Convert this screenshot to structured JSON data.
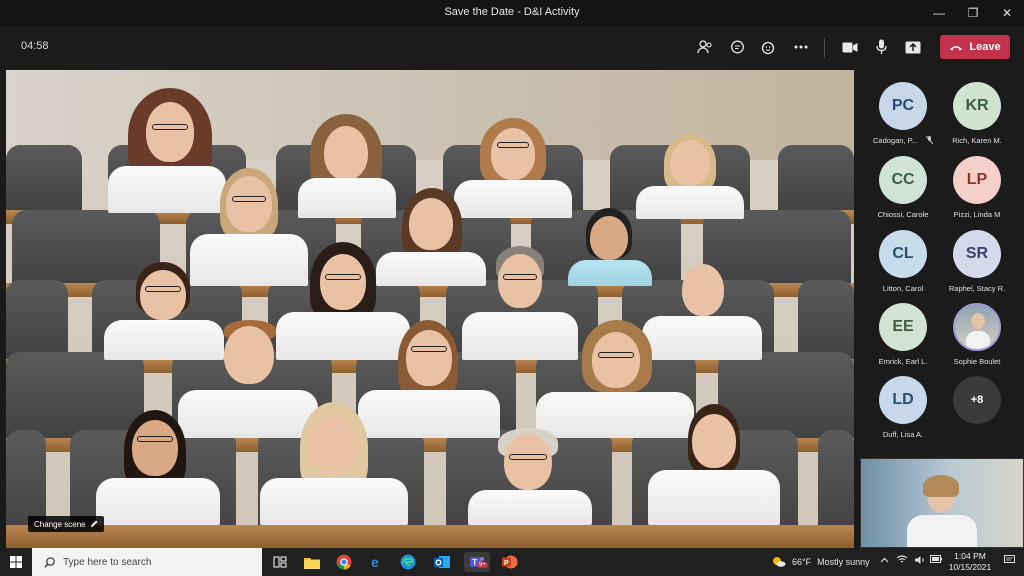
{
  "window": {
    "title": "Save the Date - D&I Activity",
    "minimize": "—",
    "restore": "❐",
    "close": "✕"
  },
  "meeting": {
    "timer": "04:58",
    "leave_label": "Leave",
    "accent": "#c4314b"
  },
  "stage": {
    "change_scene": "Change scene"
  },
  "roster": [
    {
      "initials": "PC",
      "name": "Cadogan, P...",
      "muted": true,
      "bg": "#c7d7e8",
      "fg": "#2a4a6e"
    },
    {
      "initials": "KR",
      "name": "Rich, Karen M.",
      "muted": false,
      "bg": "#cfe3cf",
      "fg": "#3b5e3b"
    },
    {
      "initials": "CC",
      "name": "Chiossi, Carole",
      "muted": false,
      "bg": "#cfe3d6",
      "fg": "#3b5e47"
    },
    {
      "initials": "LP",
      "name": "Pizzi, Linda M",
      "muted": false,
      "bg": "#f5d0c8",
      "fg": "#8a3a2a"
    },
    {
      "initials": "CL",
      "name": "Litton, Carol",
      "muted": false,
      "bg": "#c6dceb",
      "fg": "#2b5170"
    },
    {
      "initials": "SR",
      "name": "Raphel, Stacy R.",
      "muted": false,
      "bg": "#d7d8ea",
      "fg": "#3d3f6e"
    },
    {
      "initials": "EE",
      "name": "Emrick, Earl L.",
      "muted": false,
      "bg": "#d3e3d3",
      "fg": "#3e5e3e"
    },
    {
      "initials": "",
      "name": "Sophie Boulet",
      "muted": false,
      "bg": "#9aa7b3",
      "fg": "#ffffff"
    },
    {
      "initials": "LD",
      "name": "Duff, Lisa A.",
      "muted": false,
      "bg": "#c6d8ea",
      "fg": "#2b4f72"
    },
    {
      "initials": "+8",
      "name": "",
      "muted": false,
      "bg": "#3b3b3b",
      "fg": "#ffffff"
    }
  ],
  "taskbar": {
    "search_placeholder": "Type here to search",
    "teams_badge": "9+",
    "weather_temp": "66°F",
    "weather_desc": "Mostly sunny",
    "time": "1:04 PM",
    "date": "10/15/2021"
  }
}
